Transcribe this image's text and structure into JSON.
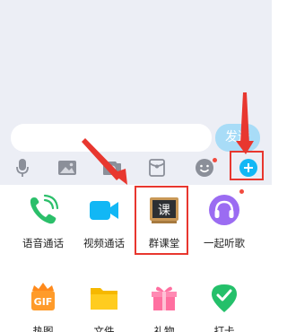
{
  "composer": {
    "input_value": "",
    "send_label": "发送"
  },
  "toolbar": {
    "icons": [
      "microphone-icon",
      "image-icon",
      "camera-icon",
      "red-packet-icon",
      "emoji-icon",
      "plus-icon"
    ]
  },
  "panel": {
    "items": [
      {
        "label": "语音通话",
        "icon": "phone-call-icon"
      },
      {
        "label": "视频通话",
        "icon": "video-call-icon"
      },
      {
        "label": "群课堂",
        "icon": "classroom-icon",
        "icon_text": "课"
      },
      {
        "label": "一起听歌",
        "icon": "headphones-icon"
      },
      {
        "label": "热图",
        "icon": "gif-icon",
        "icon_text": "GIF"
      },
      {
        "label": "文件",
        "icon": "folder-icon"
      },
      {
        "label": "礼物",
        "icon": "gift-icon"
      },
      {
        "label": "打卡",
        "icon": "check-in-icon"
      }
    ]
  },
  "colors": {
    "accent_blue": "#12b7f5",
    "send_disabled": "#a8dcf7",
    "highlight_red": "#e8372f",
    "chat_background": "#eceef5"
  }
}
